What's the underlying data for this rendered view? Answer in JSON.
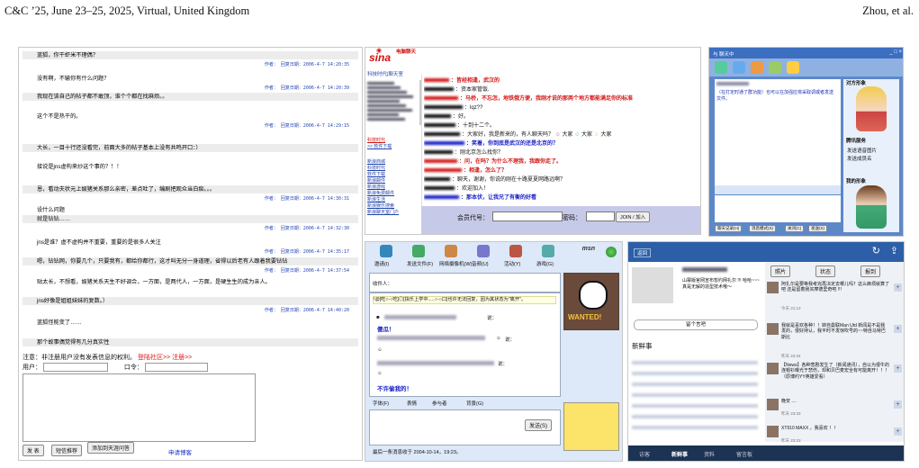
{
  "header": {
    "left": "C&C ’25, June 23–25, 2025, Virtual, United Kingdom",
    "right": "Zhou, et al."
  },
  "forum": {
    "posts": [
      {
        "text": "蓝狐，你干虾米不理偶？",
        "meta": "作者： 回复日期：2006-4-7 14:20:35"
      },
      {
        "text": "没有啊，不输你有什么问题？",
        "meta": "作者： 回复日期：2006-4-7 14:20:39"
      },
      {
        "text": "我现在该自己的帖子都不敢顶，谁个个都在找麻烦。。",
        "meta": ""
      },
      {
        "text": "这个不是热干的。",
        "meta": "作者： 回复日期：2006-4-7 14:29:15"
      },
      {
        "text": "大长，一目十行还没看完，前面大多的帖子基本上没有共鸣开口：）",
        "meta": ""
      },
      {
        "text": "接说是jns虚构来炒这个事的？！！",
        "meta": ""
      },
      {
        "text": "恩，看动夫状元上娱猪关系那么亲密，差点吐了，编剧把观众当白痴。。。",
        "meta": "作者： 回复日期：2006-4-7 14:30:31"
      },
      {
        "text": "设什么问题",
        "meta": ""
      },
      {
        "text": "就是钻钻……",
        "meta": "作者： 回复日期：2006-4-7 14:32:30"
      },
      {
        "text": "jns是谁？虚不虚构并不重要，重要的是很多人关注",
        "meta": "作者： 回复日期：2006-4-7 14:35:17"
      },
      {
        "text": "嗯，钻钻网，你要几个，只要我有，都给你都行，这才叫无分一身道理，省得以后老有人跟着我要钻钻",
        "meta": "作者： 回复日期：2006-4-7 14:37:54"
      },
      {
        "text": "贴太长，不想看，娱猪关系天生不好调合，一方面，是两代人，一方面，是硬生生的成为亲人。",
        "meta": ""
      },
      {
        "text": "jns好像是姐姐妹妹的复数。）",
        "meta": "作者： 回复日期：2006-4-7 14:40:20"
      },
      {
        "text": "蓝狐怪能变了……",
        "meta": ""
      },
      {
        "text": "那个故事偶觉得有几分真实性",
        "meta": ""
      }
    ],
    "notice": "注意：非注册用户没有发表信息的权利。",
    "notice_link1": "登陆社区>>",
    "notice_link2": "注册>>",
    "user_label": "用户：",
    "pass_label": "口令：",
    "btn_post": "发 表",
    "btn_sms": "短信推荐",
    "btn_add": "添加到天涯问答",
    "apply_blog": "申请博客"
  },
  "sina": {
    "logo": "sina",
    "logo_sub": "电脑聊天",
    "nav": "科技时代|聊天室",
    "side_links": [
      "科技时代",
      ">> 软件下载",
      "新浪商城",
      "科技时代",
      "软件下载",
      "新浪邮件",
      "新浪游戏",
      "新浪免费邮件",
      "新浪生活",
      "新浪娱乐搜索",
      "新浪聊天室门户"
    ],
    "messages": [
      {
        "text": "：皆经相逢，武汉的",
        "color": "#d41818"
      },
      {
        "text": "：资本家管饭.",
        "color": "#111"
      },
      {
        "text": "：马桥，不忘怎，地铁俄方便，我刚才说的那两个地方都能满足你的标准",
        "color": "#d41818"
      },
      {
        "text": "：lqz??",
        "color": "#111"
      },
      {
        "text": "：好。",
        "color": "#111"
      },
      {
        "text": "：十到十二个。",
        "color": "#111"
      },
      {
        "text": "：大家好，我是新来的，有人聊天吗？",
        "color": "#111"
      },
      {
        "text": "：笑着，你到底是武汉的还是北京的？",
        "color": "#1a20c8"
      },
      {
        "text": "：刚北京怎么找你？",
        "color": "#111"
      },
      {
        "text": "：问，在吗？为什么不理我，我跟你走了。",
        "color": "#d41818"
      },
      {
        "text": "：相逢，怎么了？",
        "color": "#d41818"
      },
      {
        "text": "：聊天，谢谢，你说的刚在十路夏夏网路远啊？",
        "color": "#111"
      },
      {
        "text": "：欢迎加入！",
        "color": "#111"
      },
      {
        "text": "：那本伏，让我兄了有衡的好看",
        "color": "#1a20c8"
      }
    ],
    "greet_extra": "大家",
    "member_label": "会员代号：",
    "pass_label": "密码：",
    "join_btn": "JOIN / 加入"
  },
  "qq": {
    "title": "与 聊天中",
    "notice": "（在打定时通了群功能）也可以在加强应将采取调或者发送文件。",
    "right_head1": "对方形象",
    "right_head2": "腾讯服务",
    "right_head3": "我的形象",
    "services": [
      "发送语音图片",
      "发送成员名"
    ],
    "bottom_btns": [
      "聊天记录(H)",
      "消息模式(S)",
      "关闭(C)",
      "发送(S)"
    ]
  },
  "msn": {
    "brand": "msn",
    "toolbar": [
      "邀请(I)",
      "发送文件(F)",
      "网络摄像机(W)",
      "音频(U)",
      "活动(Y)",
      "游戏(G)"
    ],
    "to_label": "收件人：",
    "warn": "!@[吃○-○吃]◎[抉乐上学中.....○-○口]也许无法回复，因为其状态为\"离开\"。",
    "said": "说：",
    "msg1": "傻瓜！",
    "msg2": "不许偷我的！",
    "badge": "WANTED!",
    "format_bar": [
      "字体(F)",
      "表情",
      "参与者",
      "背景(G)"
    ],
    "send": "发送(S)",
    "last_msg": "最后一条消息收于 2004-10-14，19:23。"
  },
  "mobile": {
    "back": "返回",
    "photos": "照片",
    "status": "状态",
    "report": "报到",
    "profile_text": "山寨版官网宣布暂约网礼尔 !!! 哈哈~~~真是无解的造型技术哦～",
    "leave_msg": "留个言吧",
    "news_title": "新鲜事",
    "feed": [
      {
        "text": "阿扎尔是要等我考完再决定去哪儿吗？这么麻烦就算了吧 还是留着我买摩德里奇吧 !!!",
        "time": "今天 21:13"
      },
      {
        "text": "我就是喜欢各种！！转自曼联Man Utd 新闻是不是我发的，很好持认，我平时不发惊吹号的~~特自马特巴斯比",
        "time": "昨天 23:34"
      },
      {
        "text": "【News】各种悲剧发生了（新闻通讯），自以为很牛的连帽衫曝光于悲伤，却和贝巴麦宏全有可能离开！！！（原博约YY英雄爱看）",
        "time": ""
      },
      {
        "text": "晚安 ....",
        "time": "昨天 23:33"
      },
      {
        "text": "XT910 MAXX ，我喜欢 ！！",
        "time": "昨天 23:23"
      }
    ],
    "tabs": [
      "访客",
      "新鲜事",
      "资料",
      "留言板"
    ]
  }
}
